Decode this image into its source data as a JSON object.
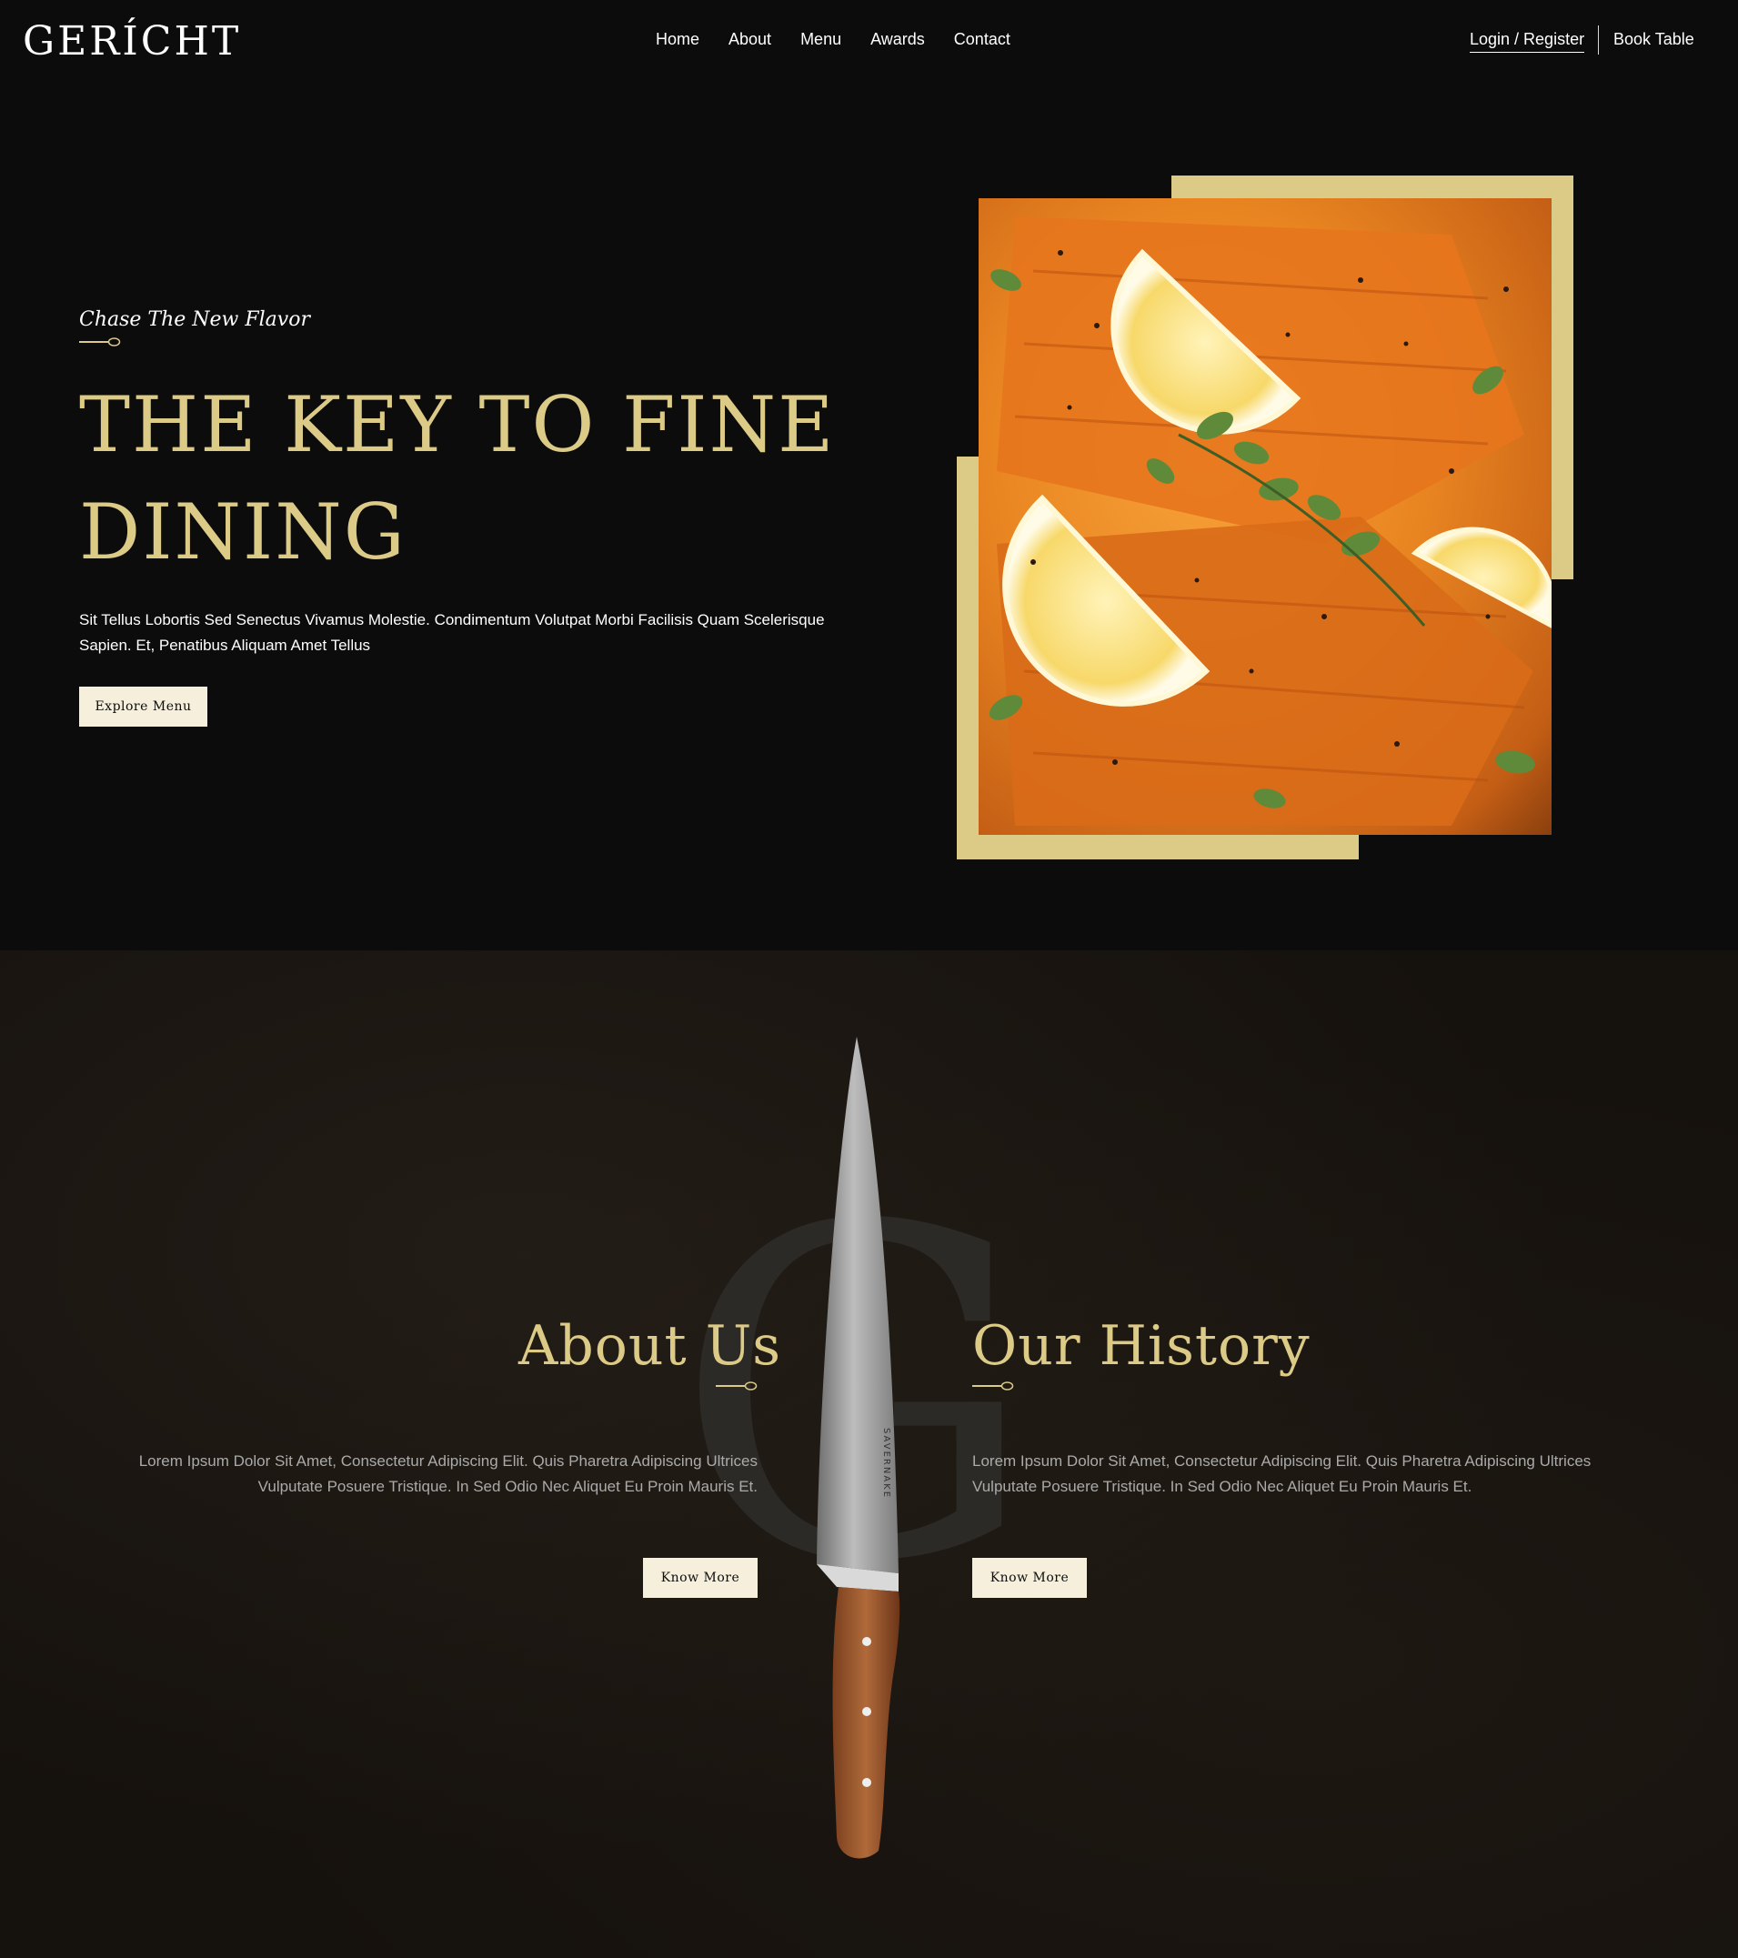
{
  "nav": {
    "logo": "GERÍCHT",
    "links": [
      "Home",
      "About",
      "Menu",
      "Awards",
      "Contact"
    ],
    "login_label": "Login / Register",
    "book_label": "Book Table"
  },
  "hero": {
    "subtitle": "Chase The New Flavor",
    "title_line1": "THE KEY TO FINE",
    "title_line2": "DINING",
    "description": "Sit Tellus Lobortis Sed Senectus Vivamus Molestie. Condimentum Volutpat Morbi Facilisis Quam Scelerisque Sapien. Et, Penatibus Aliquam Amet Tellus",
    "button_label": "Explore Menu"
  },
  "about": {
    "background_letter": "G",
    "about_title": "About Us",
    "about_text": "Lorem Ipsum Dolor Sit Amet, Consectetur Adipiscing Elit. Quis Pharetra Adipiscing Ultrices Vulputate Posuere Tristique. In Sed Odio Nec Aliquet Eu Proin Mauris Et.",
    "about_button": "Know More",
    "history_title": "Our History",
    "history_text": "Lorem Ipsum Dolor Sit Amet, Consectetur Adipiscing Elit. Quis Pharetra Adipiscing Ultrices Vulputate Posuere Tristique. In Sed Odio Nec Aliquet Eu Proin Mauris Et.",
    "history_button": "Know More",
    "knife_brand": "SAVERNAKE"
  },
  "colors": {
    "accent_gold": "#dcca87",
    "background": "#0c0c0c",
    "button_bg": "#f5efdb"
  }
}
